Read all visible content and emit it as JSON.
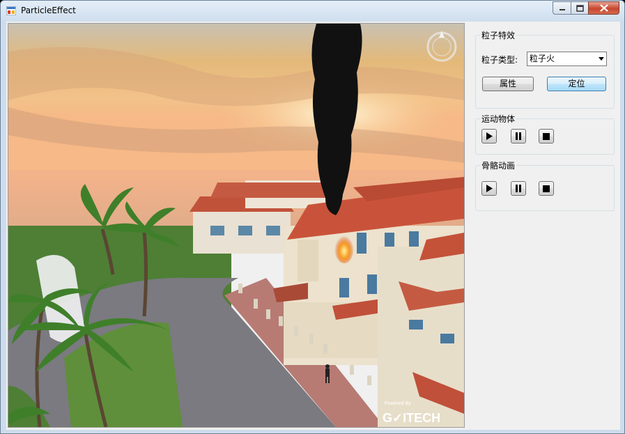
{
  "window": {
    "title": "ParticleEffect"
  },
  "viewport": {
    "watermark_small": "Powered By",
    "watermark_brand": "G✓ITECH"
  },
  "particle_group": {
    "title": "粒子特效",
    "type_label": "粒子类型:",
    "type_selected": "粒子火",
    "properties_button": "属性",
    "locate_button": "定位"
  },
  "motion_group": {
    "title": "运动物体",
    "buttons": [
      "play-icon",
      "pause-icon",
      "stop-icon"
    ]
  },
  "skeleton_group": {
    "title": "骨骼动画",
    "buttons": [
      "play-icon",
      "pause-icon",
      "stop-icon"
    ]
  },
  "colors": {
    "frame": "#cddcec",
    "close": "#c7462e",
    "focus": "#3c7fb1"
  }
}
